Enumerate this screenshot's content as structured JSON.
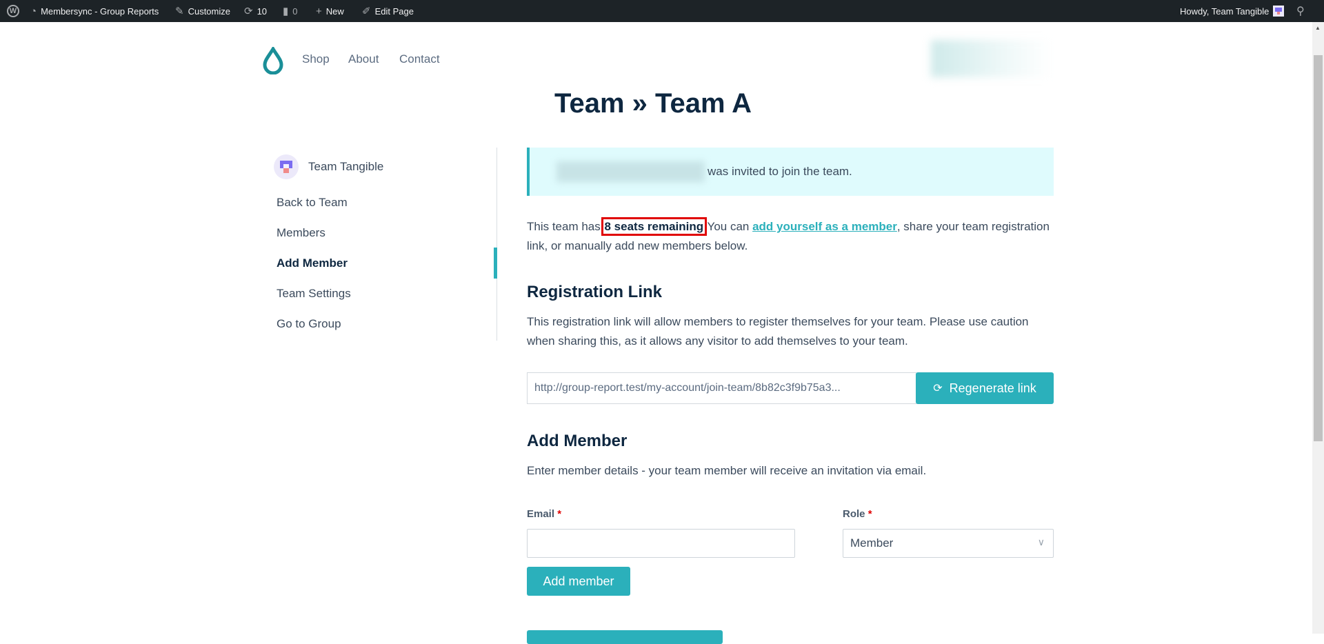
{
  "admin_bar": {
    "site_name": "Membersync - Group Reports",
    "customize": "Customize",
    "updates": "10",
    "comments": "0",
    "new": "New",
    "edit_page": "Edit Page",
    "howdy": "Howdy, Team Tangible"
  },
  "nav": {
    "items": [
      "Shop",
      "About",
      "Contact"
    ]
  },
  "page_title": "Team » Team A",
  "sidebar": {
    "team_name": "Team Tangible",
    "items": [
      {
        "label": "Back to Team"
      },
      {
        "label": "Members"
      },
      {
        "label": "Add Member",
        "active": true
      },
      {
        "label": "Team Settings"
      },
      {
        "label": "Go to Group"
      }
    ]
  },
  "notice": {
    "text": "was invited to join the team."
  },
  "intro": {
    "prefix": "This team has ",
    "seats": "8 seats remaining",
    "middle": " You can ",
    "link": "add yourself as a member",
    "suffix": ", share your team registration link, or manually add new members below."
  },
  "registration": {
    "heading": "Registration Link",
    "description": "This registration link will allow members to register themselves for your team. Please use caution when sharing this, as it allows any visitor to add themselves to your team.",
    "link_value": "http://group-report.test/my-account/join-team/8b82c3f9b75a3...",
    "regenerate_label": "Regenerate link"
  },
  "add_member": {
    "heading": "Add Member",
    "description": "Enter member details - your team member will receive an invitation via email.",
    "email_label": "Email",
    "role_label": "Role",
    "required_mark": "*",
    "email_value": "",
    "role_value": "Member",
    "submit_label": "Add member"
  },
  "colors": {
    "accent": "#2bb0bb",
    "heading": "#0e2740",
    "notice_bg": "#dffbfd",
    "highlight": "#e00000",
    "admin_bar": "#1d2327"
  }
}
